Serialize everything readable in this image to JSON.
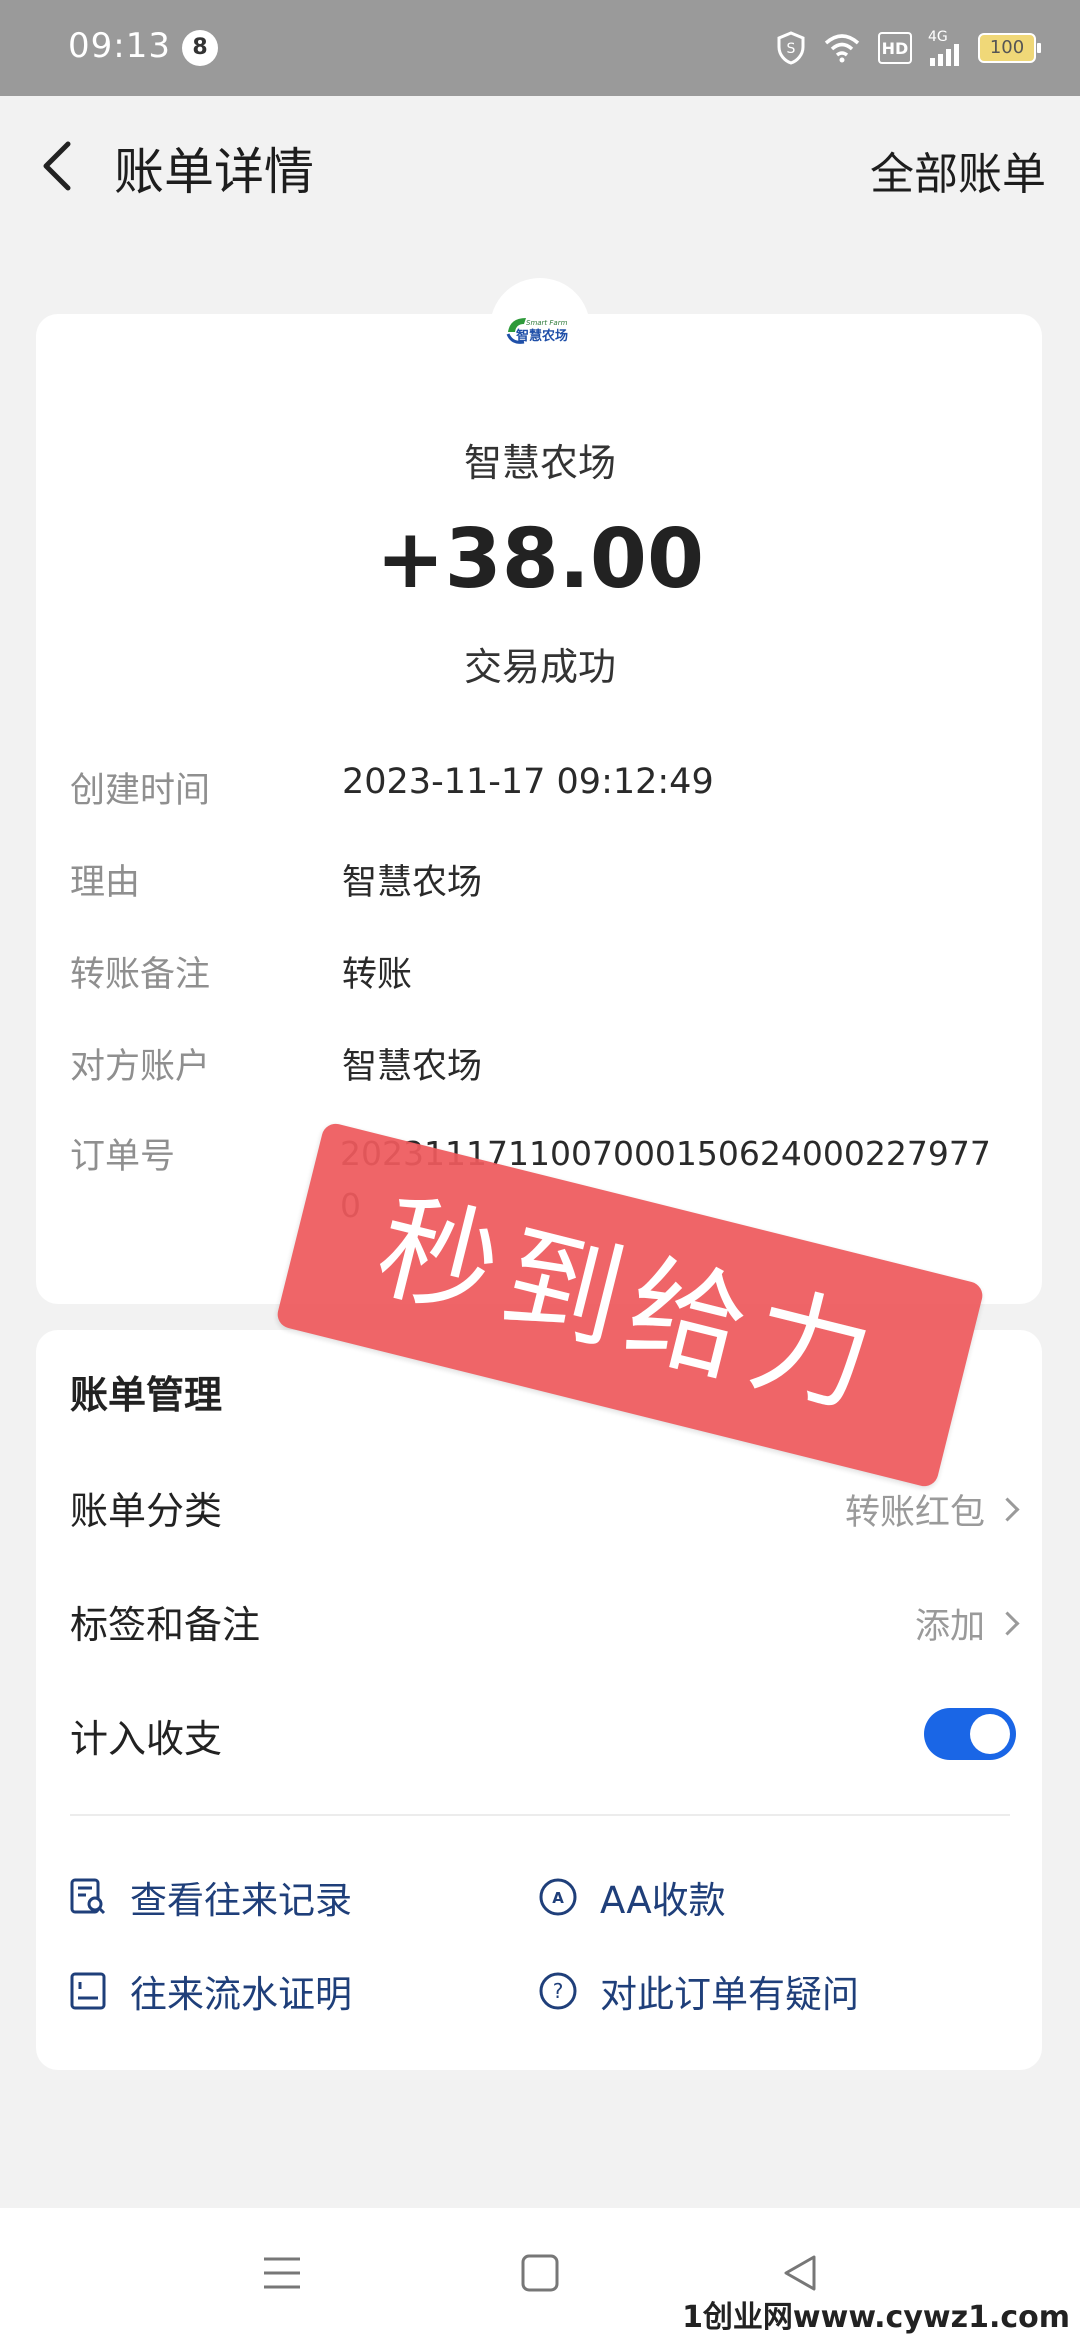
{
  "status_bar": {
    "time": "09:13",
    "notification_count": "8",
    "hd": "HD",
    "network": "4G",
    "battery": "100"
  },
  "header": {
    "title": "账单详情",
    "right_link": "全部账单"
  },
  "merchant": {
    "logo_text": "智慧农场",
    "logo_subtext": "Smart Farm",
    "name": "智慧农场"
  },
  "transaction": {
    "amount": "+38.00",
    "status": "交易成功",
    "details": [
      {
        "label": "创建时间",
        "value": "2023-11-17 09:12:49"
      },
      {
        "label": "理由",
        "value": "智慧农场"
      },
      {
        "label": "转账备注",
        "value": "转账"
      },
      {
        "label": "对方账户",
        "value": "智慧农场"
      },
      {
        "label": "订单号",
        "value": "20231117110070001506240002279770"
      }
    ]
  },
  "stamp": {
    "text": "秒到给力"
  },
  "management": {
    "title": "账单管理",
    "category": {
      "label": "账单分类",
      "value": "转账红包"
    },
    "tags": {
      "label": "标签和备注",
      "value": "添加"
    },
    "include": {
      "label": "计入收支",
      "enabled": true
    },
    "actions": [
      {
        "label": "查看往来记录",
        "icon": "records-icon"
      },
      {
        "label": "AA收款",
        "icon": "aa-icon"
      },
      {
        "label": "往来流水证明",
        "icon": "statement-icon"
      },
      {
        "label": "对此订单有疑问",
        "icon": "question-icon"
      }
    ]
  },
  "watermark": "1创业网www.cywz1.com",
  "colors": {
    "accent": "#1a66e6",
    "stamp": "#ee5a5d",
    "link": "#1f3f7a"
  }
}
